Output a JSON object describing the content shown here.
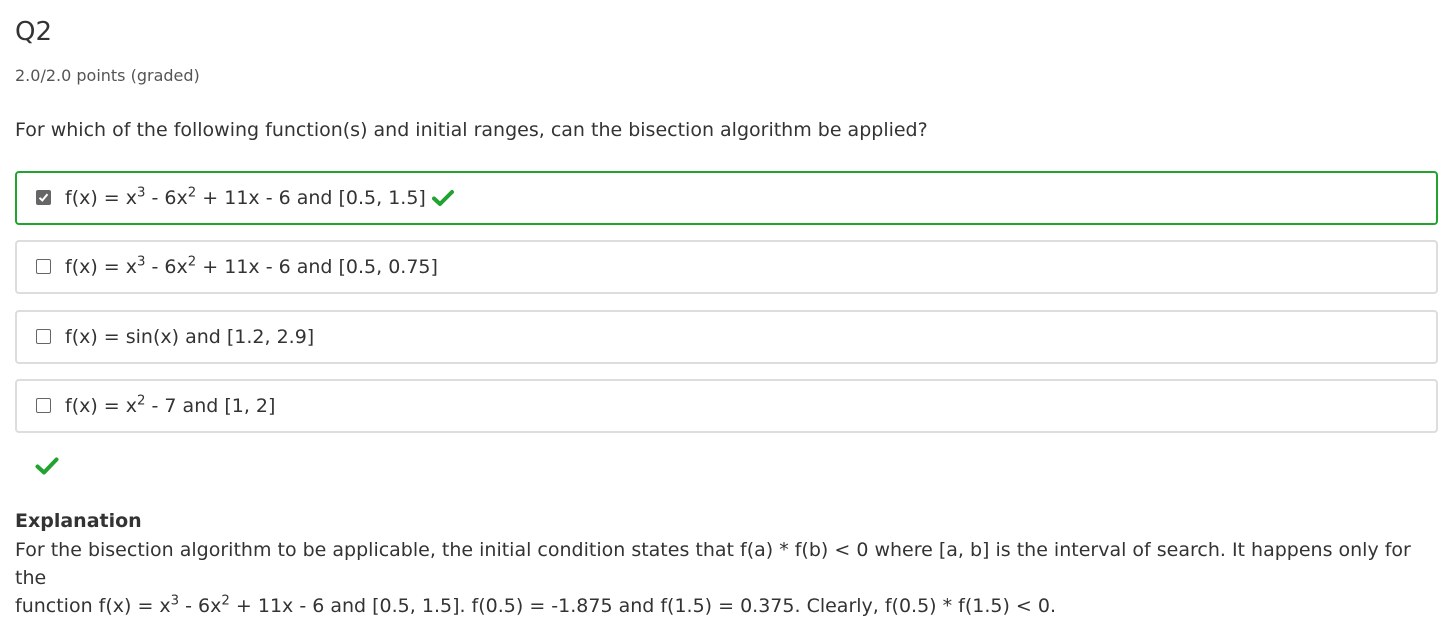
{
  "question": {
    "title": "Q2",
    "points": "2.0/2.0 points (graded)",
    "prompt": "For which of the following function(s) and initial ranges, can the bisection algorithm be applied?"
  },
  "options": [
    {
      "pre": "f(x) = x",
      "sup1": "3",
      "mid": " - 6x",
      "sup2": "2",
      "post": " + 11x - 6 and [0.5, 1.5]",
      "checked": true,
      "status": "correct"
    },
    {
      "pre": "f(x) = x",
      "sup1": "3",
      "mid": " - 6x",
      "sup2": "2",
      "post": " + 11x - 6 and [0.5, 0.75]",
      "checked": false
    },
    {
      "text": "f(x) = sin(x) and [1.2, 2.9]",
      "checked": false
    },
    {
      "pre": "f(x) = x",
      "sup1": "2",
      "post": " - 7 and [1, 2]",
      "checked": false
    }
  ],
  "result": {
    "status_icon": "check-icon",
    "color": "#22a22f"
  },
  "explanation": {
    "heading": "Explanation",
    "line1": "For the bisection algorithm to be applicable, the initial condition states that f(a) * f(b) < 0 where [a, b] is the interval of search. It happens only for the",
    "line2_pre": "function f(x) = x",
    "line2_sup1": "3",
    "line2_mid": " - 6x",
    "line2_sup2": "2",
    "line2_post": " + 11x - 6 and [0.5, 1.5]. f(0.5) = -1.875 and f(1.5) = 0.375. Clearly, f(0.5) * f(1.5) < 0."
  },
  "colors": {
    "accent_green": "#22a22f",
    "border": "#dddddd",
    "text": "#333333"
  }
}
